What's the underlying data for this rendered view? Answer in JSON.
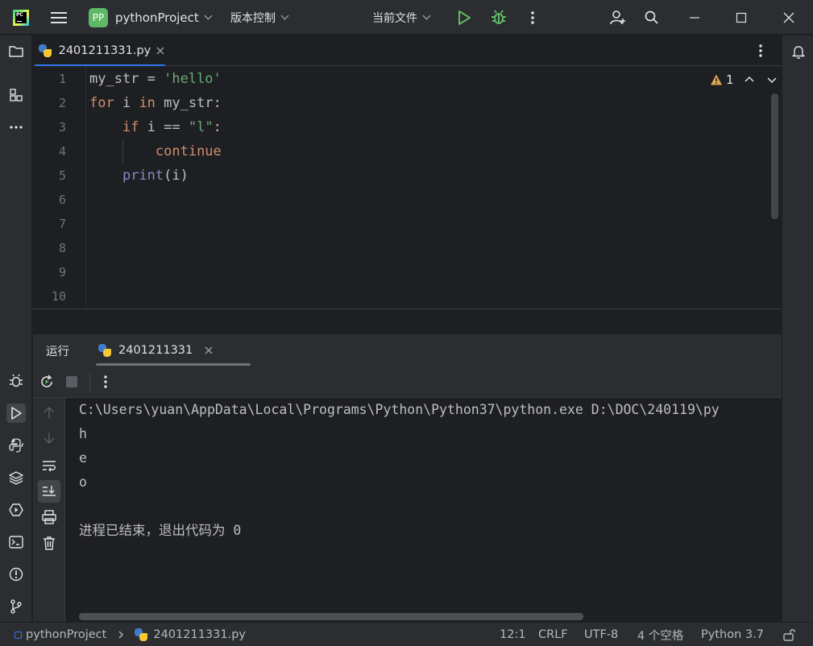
{
  "titlebar": {
    "logo_text": "PC",
    "project_badge": "PP",
    "project_name": "pythonProject",
    "vcs_label": "版本控制",
    "run_config": "当前文件"
  },
  "editor": {
    "tab_label": "2401211331.py",
    "problems_count": "1",
    "line_numbers": [
      "1",
      "2",
      "3",
      "4",
      "5",
      "6",
      "7",
      "8",
      "9",
      "10"
    ],
    "code": {
      "l1_ident": "my_str = ",
      "l1_str": "'hello'",
      "l2_kw1": "for",
      "l2_ident1": " i ",
      "l2_kw2": "in",
      "l2_ident2": " my_str:",
      "l3_kw": "if",
      "l3_ident": " i == ",
      "l3_str": "\"l\"",
      "l3_colon": ":",
      "l4_kw": "continue",
      "l5_builtin": "print",
      "l5_ident": "(i)"
    }
  },
  "run_panel": {
    "run_label": "运行",
    "tab_label": "2401211331",
    "console_lines": [
      "C:\\Users\\yuan\\AppData\\Local\\Programs\\Python\\Python37\\python.exe D:\\DOC\\240119\\py",
      "h",
      "e",
      "o",
      "",
      "进程已结束，退出代码为 0"
    ]
  },
  "statusbar": {
    "project": "pythonProject",
    "file": "2401211331.py",
    "position": "12:1",
    "line_sep": "CRLF",
    "encoding": "UTF-8",
    "indent": "4 个空格",
    "interpreter": "Python 3.7"
  },
  "colors": {
    "accent": "#3574f0",
    "keyword": "#cf8e6d",
    "string": "#6aab73",
    "builtin": "#8888c6",
    "run_green": "#5fb865",
    "warning": "#e0a650"
  }
}
